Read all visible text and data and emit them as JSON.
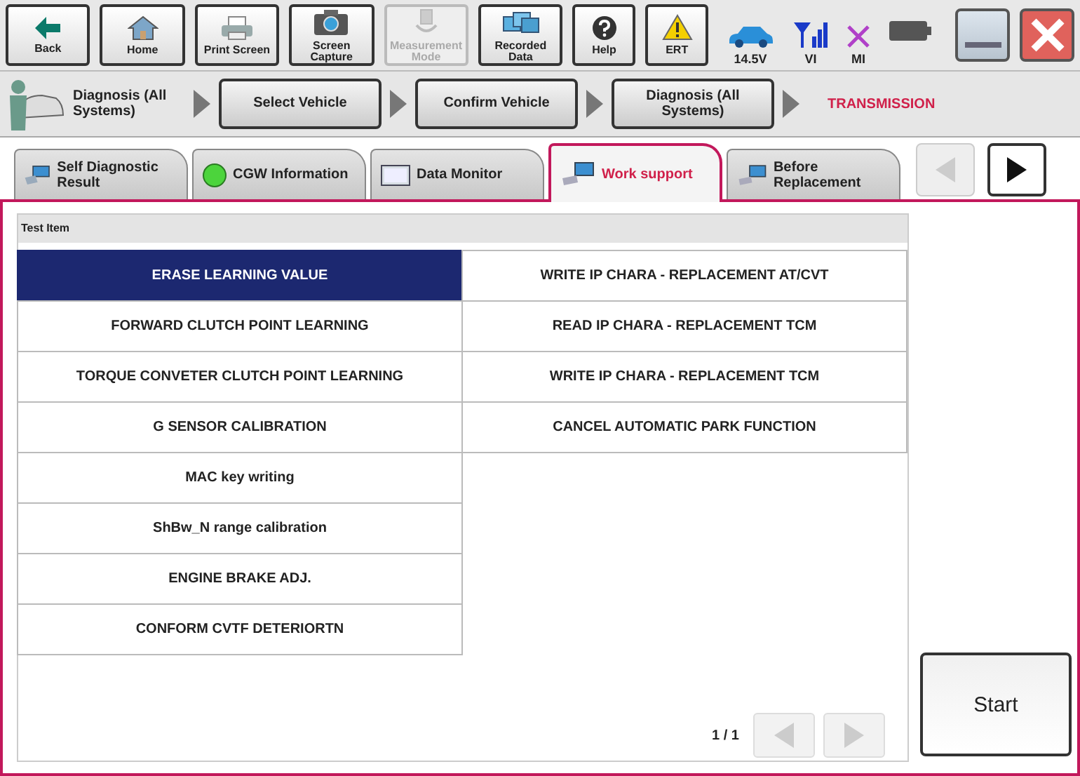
{
  "toolbar": {
    "buttons": [
      {
        "kind": "back",
        "label": "Back",
        "disabled": false
      },
      {
        "kind": "home",
        "label": "Home",
        "disabled": false
      },
      {
        "kind": "print",
        "label": "Print Screen",
        "disabled": false
      },
      {
        "kind": "camera",
        "label": "Screen Capture",
        "disabled": false
      },
      {
        "kind": "measure",
        "label": "Measurement Mode",
        "disabled": true
      },
      {
        "kind": "recorded",
        "label": "Recorded Data",
        "disabled": false
      },
      {
        "kind": "help",
        "label": "Help",
        "disabled": false
      },
      {
        "kind": "warning",
        "label": "ERT",
        "disabled": false
      }
    ],
    "status": {
      "voltage": "14.5V",
      "vi": "VI",
      "mi": "MI"
    }
  },
  "breadcrumb": {
    "root": "Diagnosis (All Systems)",
    "steps": [
      "Select Vehicle",
      "Confirm Vehicle",
      "Diagnosis (All Systems)"
    ],
    "current": "TRANSMISSION"
  },
  "tabs": [
    {
      "kind": "diagnostic",
      "label": "Self Diagnostic Result",
      "selected": false
    },
    {
      "kind": "status",
      "label": "CGW Information",
      "selected": false
    },
    {
      "kind": "monitor",
      "label": "Data Monitor",
      "selected": false
    },
    {
      "kind": "support",
      "label": "Work support",
      "selected": true
    },
    {
      "kind": "support",
      "label": "Before Replacement",
      "selected": false
    }
  ],
  "tab_nav": {
    "prev_disabled": true,
    "next_disabled": false
  },
  "table": {
    "header": "Test Item",
    "columns": [
      [
        {
          "label": "ERASE LEARNING VALUE",
          "selected": true
        },
        {
          "label": "FORWARD CLUTCH POINT LEARNING",
          "selected": false
        },
        {
          "label": "TORQUE CONVETER CLUTCH POINT LEARNING",
          "selected": false
        },
        {
          "label": "G SENSOR CALIBRATION",
          "selected": false
        },
        {
          "label": "MAC key writing",
          "selected": false
        },
        {
          "label": "ShBw_N range calibration",
          "selected": false
        },
        {
          "label": "ENGINE BRAKE ADJ.",
          "selected": false
        },
        {
          "label": "CONFORM CVTF DETERIORTN",
          "selected": false
        }
      ],
      [
        {
          "label": "WRITE IP CHARA - REPLACEMENT AT/CVT",
          "selected": false
        },
        {
          "label": "READ IP CHARA - REPLACEMENT TCM",
          "selected": false
        },
        {
          "label": "WRITE IP CHARA - REPLACEMENT TCM",
          "selected": false
        },
        {
          "label": "CANCEL AUTOMATIC PARK FUNCTION",
          "selected": false
        }
      ]
    ]
  },
  "pager": {
    "page": "1 / 1",
    "prev_disabled": true,
    "next_disabled": true
  },
  "start_button": "Start"
}
